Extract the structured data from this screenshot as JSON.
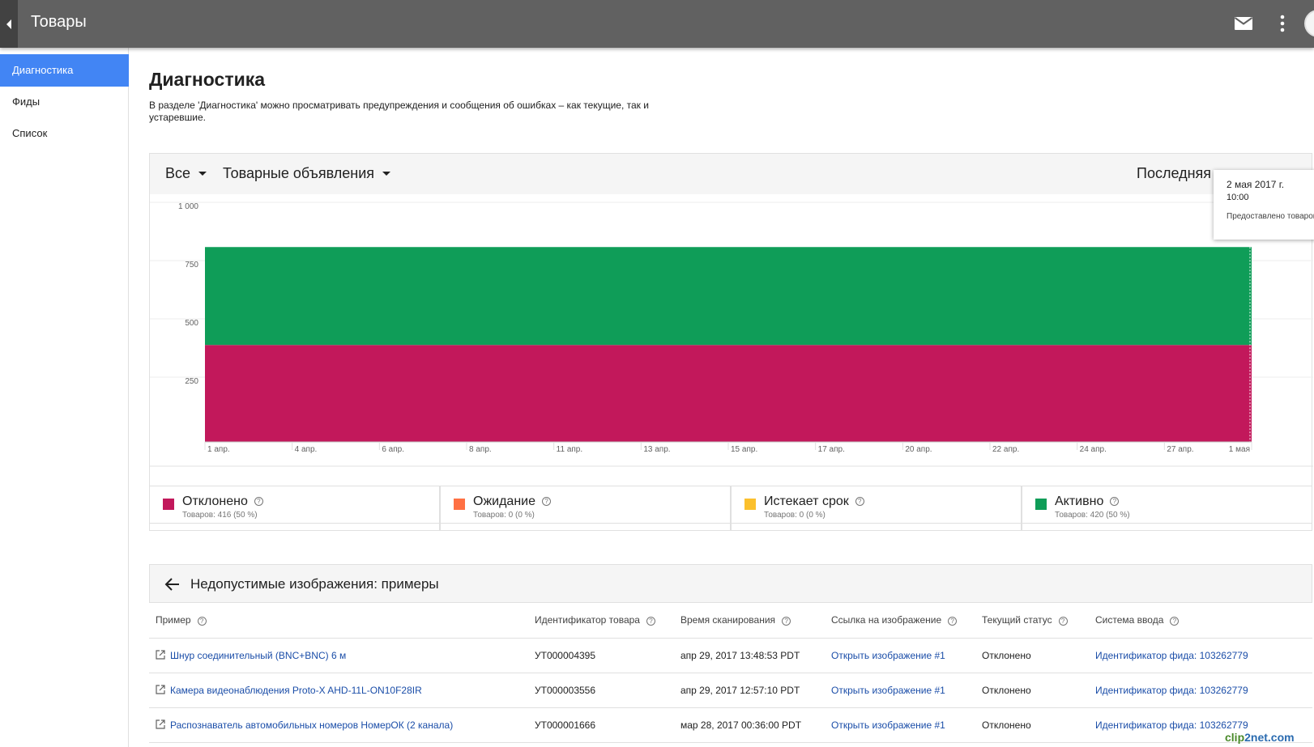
{
  "app": {
    "title": "Товары"
  },
  "sidebar": {
    "items": [
      {
        "label": "Диагностика",
        "active": true
      },
      {
        "label": "Фиды",
        "active": false
      },
      {
        "label": "Список",
        "active": false
      }
    ]
  },
  "page": {
    "title": "Диагностика",
    "description": "В разделе 'Диагностика' можно просматривать предупреждения и сообщения об ошибках – как текущие, так и устаревшие."
  },
  "filters": {
    "status": "Все",
    "destination": "Товарные объявления",
    "version": "Последняя версия ▾"
  },
  "tooltip": {
    "date": "2 мая 2017 г.",
    "time": "10:00",
    "note": "Предоставлено товаров"
  },
  "chart_data": {
    "type": "area",
    "x": [
      "1 апр.",
      "4 апр.",
      "6 апр.",
      "8 апр.",
      "11 апр.",
      "13 апр.",
      "15 апр.",
      "17 апр.",
      "20 апр.",
      "22 апр.",
      "24 апр.",
      "27 апр.",
      "1 мая"
    ],
    "yticks": [
      "1 000",
      "750",
      "500",
      "250"
    ],
    "ylim": [
      0,
      1000
    ],
    "stacked": true,
    "series": [
      {
        "name": "Отклонено",
        "color": "#c2185b",
        "values": [
          416,
          416,
          416,
          416,
          416,
          416,
          416,
          416,
          416,
          416,
          416,
          416,
          416
        ]
      },
      {
        "name": "Активно",
        "color": "#0f9d58",
        "values": [
          420,
          420,
          420,
          420,
          420,
          420,
          420,
          420,
          420,
          420,
          420,
          420,
          420
        ]
      }
    ]
  },
  "legend": [
    {
      "name": "Отклонено",
      "count": "Товаров: 416 (50 %)",
      "color": "#c2185b"
    },
    {
      "name": "Ожидание",
      "count": "Товаров: 0 (0 %)",
      "color": "#ff7043"
    },
    {
      "name": "Истекает срок",
      "count": "Товаров: 0 (0 %)",
      "color": "#fbc02d"
    },
    {
      "name": "Активно",
      "count": "Товаров: 420 (50 %)",
      "color": "#0f9d58"
    }
  ],
  "samples": {
    "title": "Недопустимые изображения: примеры",
    "columns": [
      "Пример",
      "Идентификатор товара",
      "Время сканирования",
      "Ссылка на изображение",
      "Текущий статус",
      "Система ввода"
    ],
    "rows": [
      {
        "example": "Шнур соединительный (BNC+BNC) 6 м",
        "id": "УТ000004395",
        "time": "апр 29, 2017 13:48:53 PDT",
        "link": "Открыть изображение #1",
        "status": "Отклонено",
        "source": "Идентификатор фида: 103262779"
      },
      {
        "example": "Камера видеонаблюдения Proto-X AHD-11L-ON10F28IR",
        "id": "УТ000003556",
        "time": "апр 29, 2017 12:57:10 PDT",
        "link": "Открыть изображение #1",
        "status": "Отклонено",
        "source": "Идентификатор фида: 103262779"
      },
      {
        "example": "Распознаватель автомобильных номеров НомерОК (2 канала)",
        "id": "УТ000001666",
        "time": "мар 28, 2017 00:36:00 PDT",
        "link": "Открыть изображение #1",
        "status": "Отклонено",
        "source": "Идентификатор фида: 103262779"
      }
    ]
  },
  "watermark": {
    "a": "clip",
    "b": "2net.com"
  }
}
